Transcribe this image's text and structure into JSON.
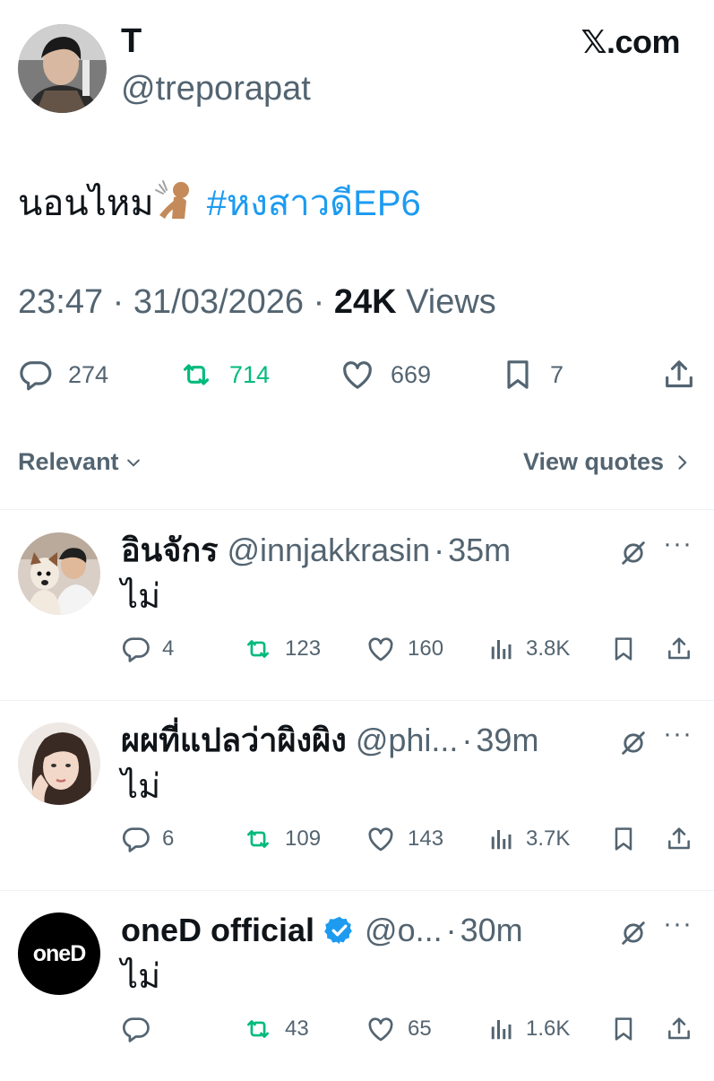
{
  "brand": "𝕏.com",
  "tweet": {
    "author_name": "T",
    "author_handle": "@treporapat",
    "text": "นอนไหม",
    "emoji": "person-bowing-hands-emoji",
    "hashtag": "#หงสาวดีEP6",
    "time": "23:47",
    "sep1": "·",
    "date": "31/03/2026",
    "sep2": "·",
    "views_count": "24K",
    "views_label": "Views",
    "replies": "274",
    "reposts": "714",
    "likes": "669",
    "bookmarks": "7"
  },
  "sort": {
    "label": "Relevant"
  },
  "view_quotes": {
    "label": "View quotes"
  },
  "colors": {
    "accent": "#1d9bf0",
    "repost_active": "#00ba7c",
    "muted": "#536471",
    "text": "#0f1419"
  },
  "replies": [
    {
      "name": "อินจักร",
      "handle": "@innjakkrasin",
      "dot": "·",
      "time": "35m",
      "text": "ไม่",
      "replies": "4",
      "reposts": "123",
      "likes": "160",
      "views": "3.8K",
      "verified": false
    },
    {
      "name": "ผผที่แปลว่าผิงผิง",
      "handle": "@phi...",
      "dot": "·",
      "time": "39m",
      "text": "ไม่",
      "replies": "6",
      "reposts": "109",
      "likes": "143",
      "views": "3.7K",
      "verified": false
    },
    {
      "name": "oneD official",
      "handle": "@o...",
      "dot": "·",
      "time": "30m",
      "text": "ไม่",
      "replies": "",
      "reposts": "43",
      "likes": "65",
      "views": "1.6K",
      "verified": true,
      "avatar_text": "oneD"
    }
  ]
}
